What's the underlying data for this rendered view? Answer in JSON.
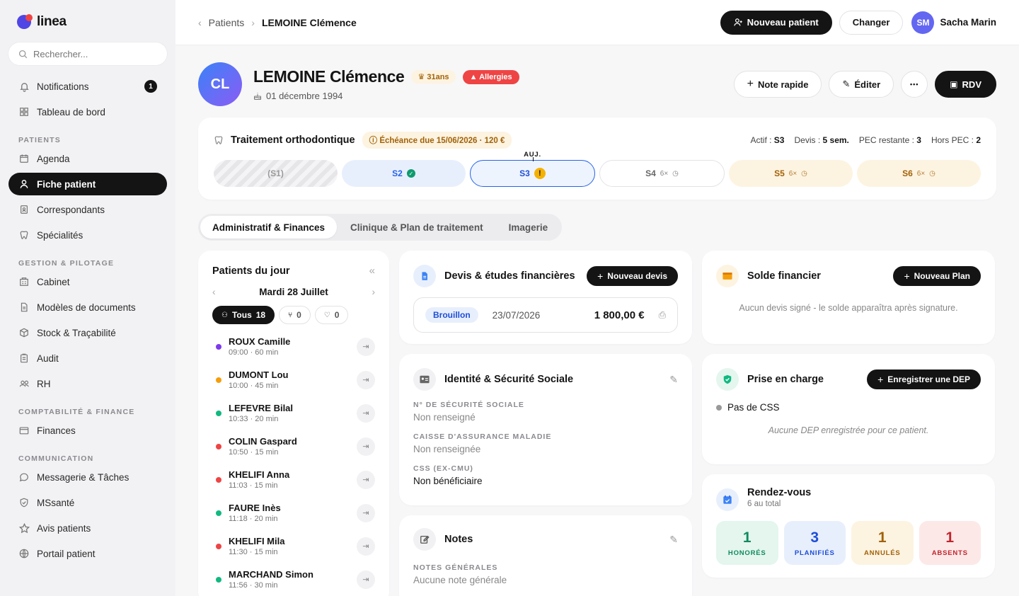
{
  "brand": {
    "name": "linea"
  },
  "search": {
    "placeholder": "Rechercher..."
  },
  "sidebar": {
    "top": [
      {
        "label": "Notifications",
        "badge": "1"
      },
      {
        "label": "Tableau de bord"
      }
    ],
    "sections": [
      {
        "title": "PATIENTS",
        "items": [
          "Agenda",
          "Fiche patient",
          "Correspondants",
          "Spécialités"
        ]
      },
      {
        "title": "GESTION & PILOTAGE",
        "items": [
          "Cabinet",
          "Modèles de documents",
          "Stock & Traçabilité",
          "Audit",
          "RH"
        ]
      },
      {
        "title": "COMPTABILITÉ & FINANCE",
        "items": [
          "Finances"
        ]
      },
      {
        "title": "COMMUNICATION",
        "items": [
          "Messagerie & Tâches",
          "MSsanté",
          "Avis patients",
          "Portail patient"
        ]
      }
    ]
  },
  "topbar": {
    "crumb_parent": "Patients",
    "crumb_current": "LEMOINE Clémence",
    "new_patient": "Nouveau patient",
    "switch": "Changer",
    "user_initials": "SM",
    "user_name": "Sacha Marin"
  },
  "patient": {
    "initials": "CL",
    "name": "LEMOINE Clémence",
    "age": "31ans",
    "allergy": "Allergies",
    "dob": "01 décembre 1994",
    "actions": {
      "quick_note": "Note rapide",
      "edit": "Éditer",
      "more": "•••",
      "rdv": "RDV"
    }
  },
  "treatment": {
    "title": "Traitement orthodontique",
    "due": "Échéance due 15/06/2026 · 120 €",
    "stats": {
      "actif_label": "Actif :",
      "actif": "S3",
      "devis_label": "Devis :",
      "devis": "5 sem.",
      "pec_label": "PEC restante :",
      "pec": "3",
      "hors_label": "Hors PEC :",
      "hors": "2"
    },
    "today": "AUJ.",
    "stages": [
      {
        "label": "(S1)",
        "count": ""
      },
      {
        "label": "S2",
        "count": ""
      },
      {
        "label": "S3",
        "count": ""
      },
      {
        "label": "S4",
        "count": "6×"
      },
      {
        "label": "S5",
        "count": "6×"
      },
      {
        "label": "S6",
        "count": "6×"
      }
    ]
  },
  "tabs": [
    "Administratif & Finances",
    "Clinique & Plan de traitement",
    "Imagerie"
  ],
  "day_patients": {
    "title": "Patients du jour",
    "date": "Mardi 28 Juillet",
    "filters": [
      {
        "label": "Tous",
        "count": "18"
      },
      {
        "label": "",
        "count": "0"
      },
      {
        "label": "",
        "count": "0"
      }
    ],
    "rows": [
      {
        "name": "ROUX Camille",
        "time": "09:00 · 60 min",
        "color": "#7c3aed"
      },
      {
        "name": "DUMONT Lou",
        "time": "10:00 · 45 min",
        "color": "#f59e0b"
      },
      {
        "name": "LEFEVRE Bilal",
        "time": "10:33 · 20 min",
        "color": "#10b981"
      },
      {
        "name": "COLIN Gaspard",
        "time": "10:50 · 15 min",
        "color": "#ef4444"
      },
      {
        "name": "KHELIFI Anna",
        "time": "11:03 · 15 min",
        "color": "#ef4444"
      },
      {
        "name": "FAURE Inès",
        "time": "11:18 · 20 min",
        "color": "#10b981"
      },
      {
        "name": "KHELIFI Mila",
        "time": "11:30 · 15 min",
        "color": "#ef4444"
      },
      {
        "name": "MARCHAND Simon",
        "time": "11:56 · 30 min",
        "color": "#10b981"
      }
    ]
  },
  "devis": {
    "title": "Devis & études financières",
    "new": "Nouveau devis",
    "status": "Brouillon",
    "date": "23/07/2026",
    "amount": "1 800,00 €"
  },
  "identity": {
    "title": "Identité & Sécurité Sociale",
    "fields": [
      {
        "label": "N° DE SÉCURITÉ SOCIALE",
        "value": "Non renseigné"
      },
      {
        "label": "CAISSE D'ASSURANCE MALADIE",
        "value": "Non renseignée"
      },
      {
        "label": "CSS (EX-CMU)",
        "value": "Non bénéficiaire"
      }
    ]
  },
  "notes": {
    "title": "Notes",
    "label": "NOTES GÉNÉRALES",
    "value": "Aucune note générale"
  },
  "solde": {
    "title": "Solde financier",
    "new": "Nouveau Plan",
    "message": "Aucun devis signé - le solde apparaîtra après signature."
  },
  "prise": {
    "title": "Prise en charge",
    "new": "Enregistrer une DEP",
    "css": "Pas de CSS",
    "message": "Aucune DEP enregistrée pour ce patient."
  },
  "rdv": {
    "title": "Rendez-vous",
    "subtitle": "6 au total",
    "tiles": [
      {
        "n": "1",
        "label": "HONORÉS",
        "fg": "#0f8a5f",
        "bg": "#e4f6ee"
      },
      {
        "n": "3",
        "label": "PLANIFIÉS",
        "fg": "#1d4ed8",
        "bg": "#e8effc"
      },
      {
        "n": "1",
        "label": "ANNULÉS",
        "fg": "#a16207",
        "bg": "#fdf3e1"
      },
      {
        "n": "1",
        "label": "ABSENTS",
        "fg": "#c0262d",
        "bg": "#fde8e8"
      }
    ]
  }
}
